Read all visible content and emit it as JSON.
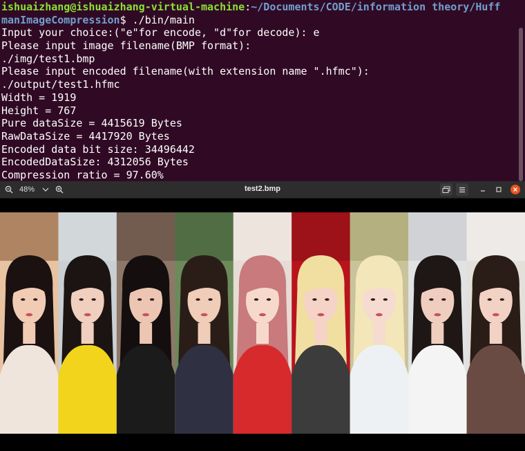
{
  "terminal": {
    "prompt": {
      "user": "ishuaizhang@ishuaizhang-virtual-machine",
      "path": "~/Documents/CODE/information theory/HuffmanImageCompression",
      "command": "./bin/main"
    },
    "lines": [
      "Input your choice:(\"e\"for encode, \"d\"for decode): e",
      "Please input image filename(BMP format):",
      "./img/test1.bmp",
      "Please input encoded filename(with extension name \".hfmc\"):",
      "./output/test1.hfmc",
      "Width = 1919",
      "Height = 767",
      "Pure dataSize = 4415619 Bytes",
      "RawDataSize = 4417920 Bytes",
      "Encoded data bit size: 34496442",
      "EncodedDataSize: 4312056 Bytes",
      "Compression ratio = 97.60%"
    ]
  },
  "viewer": {
    "title": "test2.bmp",
    "zoom": "48%",
    "icons": {
      "zoom_out": "zoom-out-icon",
      "zoom_menu": "chevron-down-icon",
      "zoom_in": "zoom-in-icon",
      "gallery": "gallery-icon",
      "menu": "hamburger-icon",
      "minimize": "minimize-icon",
      "maximize": "maximize-icon",
      "close": "close-icon"
    },
    "accent_close": "#e95420",
    "photo_panels": [
      {
        "bg": "#e7c3a1",
        "top": "#8a5a3a",
        "hair": "#1a1110",
        "skin": "#f1cbb4",
        "clothes": "#efe5dc"
      },
      {
        "bg": "#c9cfd3",
        "top": "#d9dde0",
        "hair": "#1b1412",
        "skin": "#f0cfbf",
        "clothes": "#f2d41c"
      },
      {
        "bg": "#8f7767",
        "top": "#5d4b40",
        "hair": "#140f0e",
        "skin": "#ecc6b2",
        "clothes": "#1b1b1b"
      },
      {
        "bg": "#6c8a5a",
        "top": "#3f5a36",
        "hair": "#2a1d17",
        "skin": "#f0cdb8",
        "clothes": "#2f3142"
      },
      {
        "bg": "#e6dcd5",
        "top": "#f2eae4",
        "hair": "#c87a7c",
        "skin": "#f7d9cb",
        "clothes": "#d62a2d"
      },
      {
        "bg": "#b8141c",
        "top": "#8b0f15",
        "hair": "#f1dfa1",
        "skin": "#f5d3c6",
        "clothes": "#3c3c3c"
      },
      {
        "bg": "#c8c39a",
        "top": "#a6a36f",
        "hair": "#f3e6b8",
        "skin": "#f6dbd0",
        "clothes": "#eef1f4"
      },
      {
        "bg": "#e0e2e4",
        "top": "#c5c8cb",
        "hair": "#1e1715",
        "skin": "#f0cebf",
        "clothes": "#f4f4f4"
      },
      {
        "bg": "#e3dfdb",
        "top": "#f3f1ee",
        "hair": "#2a1c17",
        "skin": "#f2d2c4",
        "clothes": "#6a4b43"
      }
    ]
  }
}
